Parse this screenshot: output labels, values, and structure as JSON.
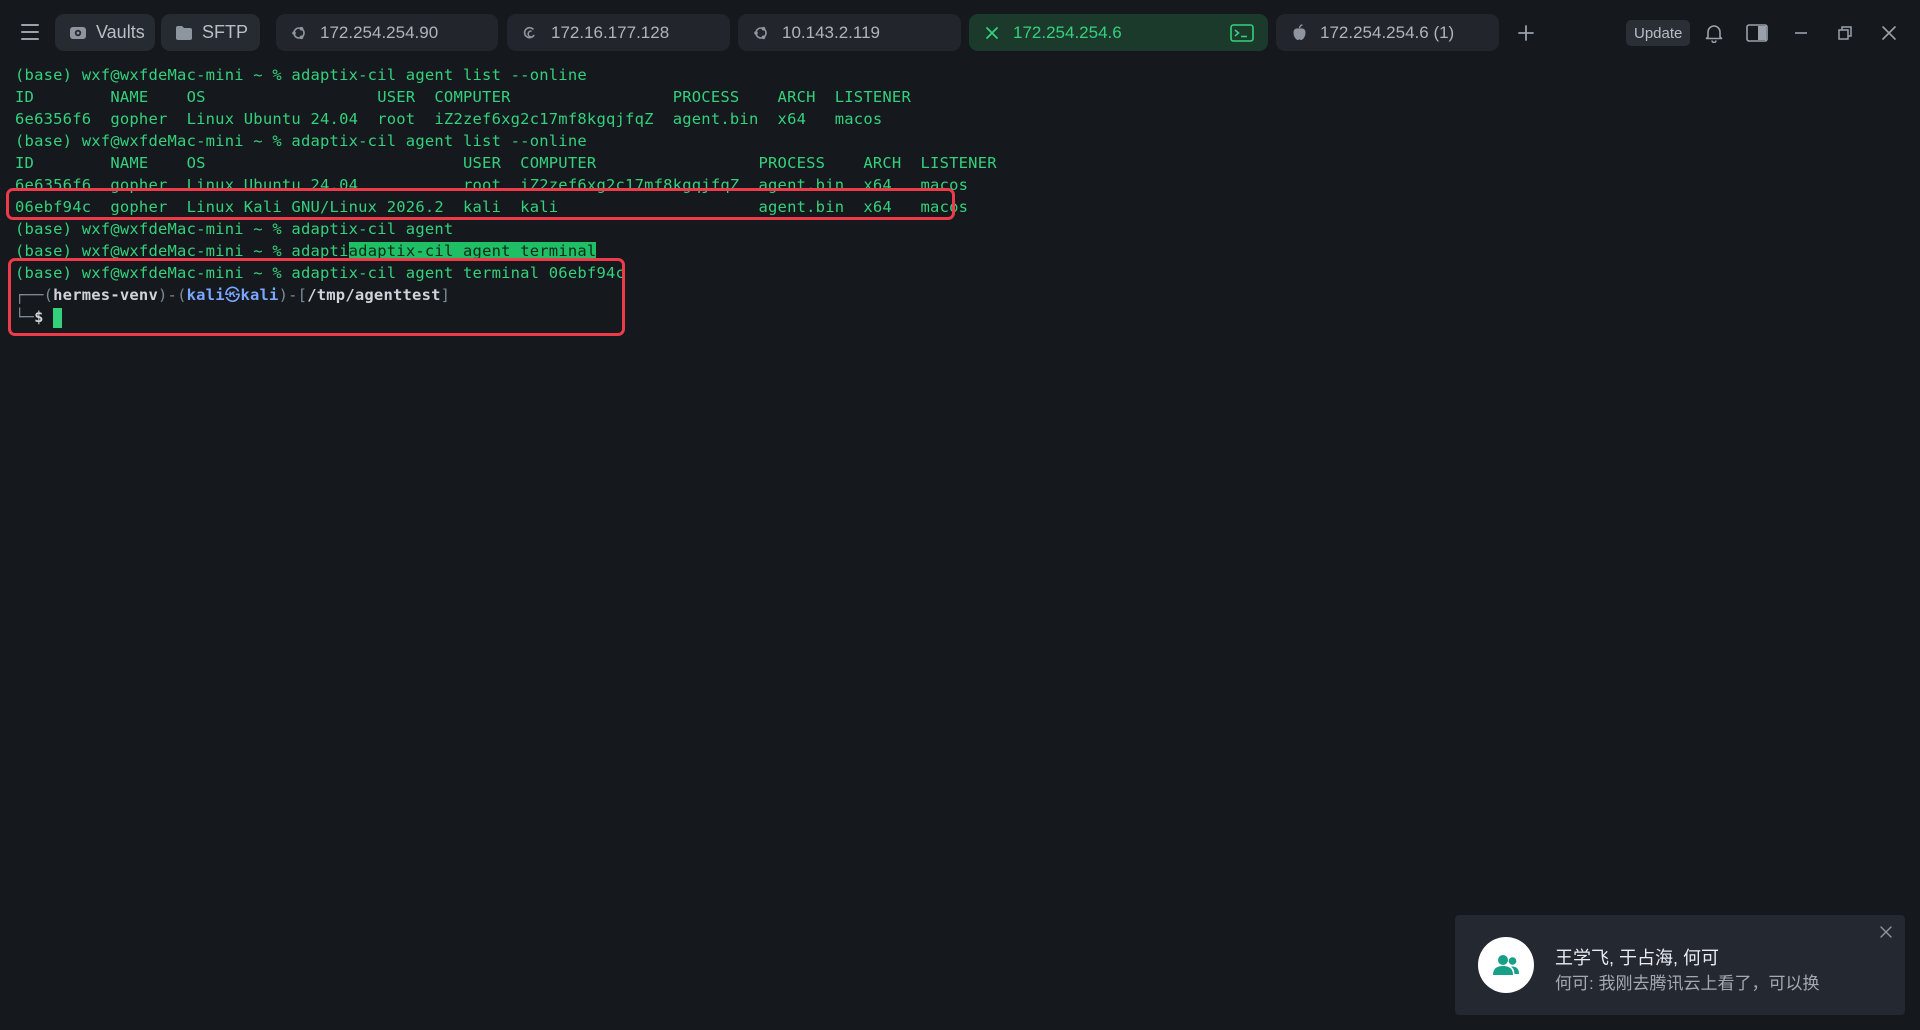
{
  "topbar": {
    "vaults_label": "Vaults",
    "sftp_label": "SFTP",
    "tabs": [
      {
        "label": "172.254.254.90",
        "icon": "ubuntu-icon"
      },
      {
        "label": "172.16.177.128",
        "icon": "debian-icon"
      },
      {
        "label": "10.143.2.119",
        "icon": "ubuntu-icon"
      },
      {
        "label": "172.254.254.6",
        "icon": "close-icon",
        "active": true
      },
      {
        "label": "172.254.254.6 (1)",
        "icon": "apple-icon"
      }
    ],
    "update_label": "Update"
  },
  "terminal": {
    "lines": [
      "(base) wxf@wxfdeMac-mini ~ % adaptix-cil agent list --online",
      "ID        NAME    OS                  USER  COMPUTER                 PROCESS    ARCH  LISTENER",
      "6e6356f6  gopher  Linux Ubuntu 24.04  root  iZ2zef6xg2c17mf8kgqjfqZ  agent.bin  x64   macos",
      "(base) wxf@wxfdeMac-mini ~ % adaptix-cil agent list --online",
      "ID        NAME    OS                           USER  COMPUTER                 PROCESS    ARCH  LISTENER",
      "6e6356f6  gopher  Linux Ubuntu 24.04           root  iZ2zef6xg2c17mf8kgqjfqZ  agent.bin  x64   macos",
      "06ebf94c  gopher  Linux Kali GNU/Linux 2026.2  kali  kali                     agent.bin  x64   macos",
      "(base) wxf@wxfdeMac-mini ~ % adaptix-cil agent",
      "(base) wxf@wxfdeMac-mini ~ % adapti",
      "(base) wxf@wxfdeMac-mini ~ % adaptix-cil agent terminal 06ebf94c"
    ],
    "autocomplete_suggestion": "adaptix-cil agent terminal",
    "kali_prompt": {
      "corner": "┌──(",
      "venv": "hermes-venv",
      "sep1": ")-(",
      "user": "kali",
      "at": "㉿",
      "host": "kali",
      "sep2": ")-[",
      "path": "/tmp/agenttest",
      "end": "]",
      "corner2": "└─",
      "dollar": "$"
    }
  },
  "notification": {
    "title": "王学飞, 于占海, 何可",
    "message": "何可: 我刚去腾讯云上看了，可以换"
  },
  "colors": {
    "background": "#15181d",
    "terminal_green": "#34d17c",
    "active_tab_bg": "#1b3a2c",
    "highlight_box": "#ee3b4a"
  }
}
